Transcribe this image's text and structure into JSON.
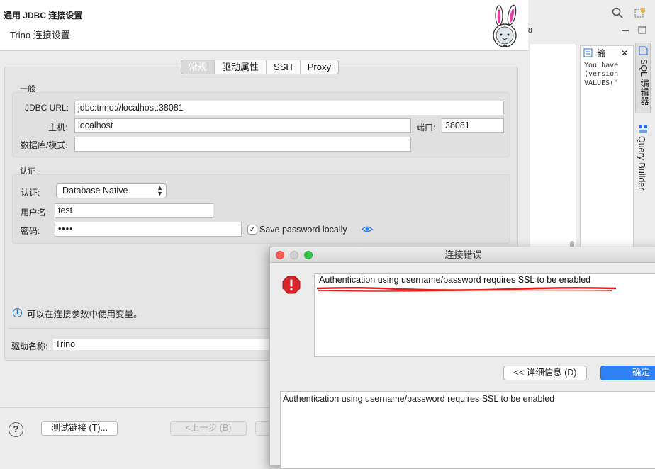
{
  "header": {
    "title": "通用 JDBC 连接设置",
    "subtitle": "Trino 连接设置"
  },
  "tabs": [
    "常规",
    "驱动属性",
    "SSH",
    "Proxy"
  ],
  "general": {
    "group_label": "一般",
    "jdbc_url_label": "JDBC URL:",
    "jdbc_url_value": "jdbc:trino://localhost:38081",
    "host_label": "主机:",
    "host_value": "localhost",
    "port_label": "端口:",
    "port_value": "38081",
    "database_label": "数据库/模式:",
    "database_value": ""
  },
  "auth": {
    "group_label": "认证",
    "auth_label": "认证:",
    "auth_value": "Database Native",
    "username_label": "用户名:",
    "username_value": "test",
    "password_label": "密码:",
    "password_value": "••••",
    "save_password_label": "Save password locally",
    "save_password_checked": true,
    "checkmark": "✓"
  },
  "info_text": "可以在连接参数中使用变量。",
  "driver": {
    "label": "驱动名称:",
    "value": "Trino"
  },
  "footer": {
    "help": "?",
    "test_button": "测试链接 (T)...",
    "back_button": "<上一步 (B)"
  },
  "ide": {
    "output_tab": "输",
    "output_lines": [
      "You have",
      "(version",
      "VALUES('"
    ],
    "sql_editor_label": "SQL 编辑器",
    "query_builder_label": "Query Builder",
    "small_badge": "8"
  },
  "error_dialog": {
    "title": "连接错误",
    "message": "Authentication using username/password requires SSL to be enabled",
    "details_button": "<< 详细信息 (D)",
    "ok_button": "确定",
    "details_text": "Authentication using username/password requires SSL to be enabled"
  },
  "colors": {
    "ok_button": "#2f7ff5",
    "error_icon": "#d9262b",
    "annotation_underline": "#e0201b",
    "traffic_close": "#fc605c",
    "traffic_max": "#34c84a"
  }
}
